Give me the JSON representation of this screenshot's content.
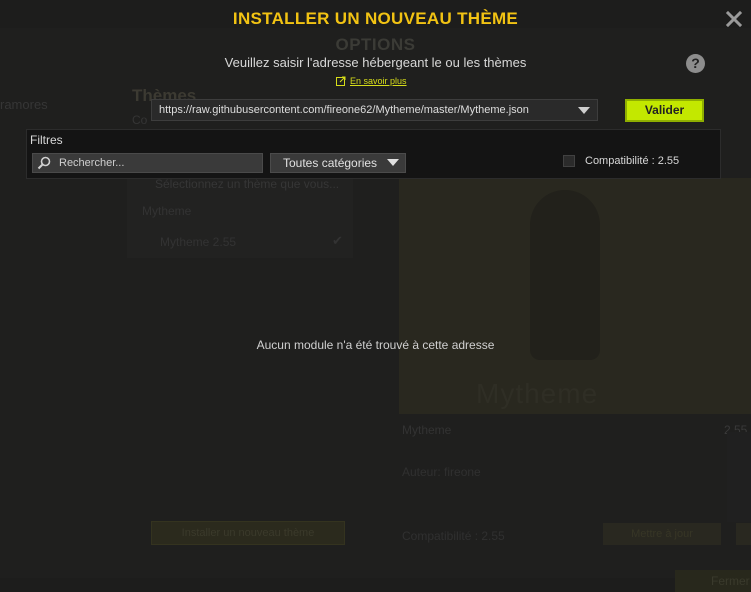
{
  "background": {
    "window_title": "OPTIONS",
    "sidebar_text": "ramores",
    "section_heading": "Thèmes",
    "section_sub": "Co",
    "list_item_1": "Sélectionnez un thème que vous...",
    "list_item_2": "Mytheme",
    "list_item_3": "Mytheme 2.55",
    "preview_text": "Mytheme",
    "meta_name": "Mytheme",
    "meta_version": "2.55",
    "meta_author": "Auteur: fireone",
    "meta_compat": "Compatibilité : 2.55",
    "btn_install": "Installer un nouveau thème",
    "btn_update": "Mettre à jour",
    "footer_close": "Fermer"
  },
  "modal": {
    "title": "INSTALLER UN NOUVEAU THÈME",
    "prompt": "Veuillez saisir l'adresse hébergeant le ou les thèmes",
    "learn_more": "En savoir plus",
    "help": "?",
    "url_value": "https://raw.githubusercontent.com/fireone62/Mytheme/master/Mytheme.json",
    "validate_label": "Valider",
    "filters_label": "Filtres",
    "search_placeholder": "Rechercher...",
    "category_selected": "Toutes catégories",
    "compat_label": "Compatibilité : 2.55",
    "empty_message": "Aucun module n'a été trouvé à cette adresse"
  },
  "colors": {
    "accent_title": "#f2c313",
    "validate_button": "#c3e800",
    "link": "#d6dd19"
  }
}
